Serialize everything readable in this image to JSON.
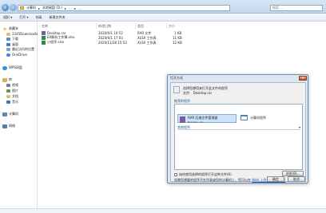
{
  "window": {
    "address_segments": [
      "计算机",
      "本地磁盘 (D:)",
      "…",
      "…"
    ],
    "search_placeholder": "搜索 …"
  },
  "toolbar": {
    "items": [
      "组织 ▾",
      "打开 ▾",
      "刻录",
      "新建文件夹"
    ]
  },
  "sidebar": {
    "favorites": {
      "label": "收藏夹",
      "items": [
        "2345Downloads",
        "下载",
        "桌面",
        "最近访问的位置",
        "OneDrive"
      ]
    },
    "wps": {
      "label": "WPS网盘"
    },
    "libraries": {
      "label": "库",
      "items": [
        "视频",
        "图片",
        "文档",
        "音乐"
      ]
    },
    "computer": {
      "label": "计算机"
    },
    "network": {
      "label": "网络"
    }
  },
  "file_list": {
    "columns": [
      "名称",
      "修改日期",
      "类型",
      "大小"
    ],
    "rows": [
      {
        "name": "Desktop.rar",
        "date": "2020/6/1 10:52",
        "type": "RAR 文件",
        "size": "1 KB"
      },
      {
        "name": "EX解析工作簿.xlsx",
        "date": "2020/6/1 17:03",
        "type": "XLSX 工作表",
        "size": "11 KB"
      },
      {
        "name": "小程序.xlsx",
        "date": "2020/11/28 15:53",
        "type": "XLSX 工作表",
        "size": "12 KB"
      }
    ]
  },
  "dialog": {
    "title": "打开方式",
    "prompt": "选择您想用来打开此文件的程序",
    "file_label": "文件:",
    "file_name": "Desktop.rar",
    "recommended_label": "推荐的程序",
    "programs": [
      {
        "name": "RAR 压缩文件管理器",
        "desc": "Bandizip, Inc."
      },
      {
        "name": "计算机程序",
        "desc": ""
      }
    ],
    "other_label": "其他程序",
    "always_use_label": "始终使用选择的程序打开这种文件(K)",
    "browse_button": "浏览(B)...",
    "hint_text": "如果您想要的程序不在列表或您的计算机上，您可以在",
    "hint_link": "Web 上寻找相应的程序",
    "ok_button": "确定",
    "cancel_button": "取消"
  },
  "colors": {
    "accent": "#2d6cb5",
    "selection": "#cde3f7",
    "link": "#1a5fb4"
  }
}
